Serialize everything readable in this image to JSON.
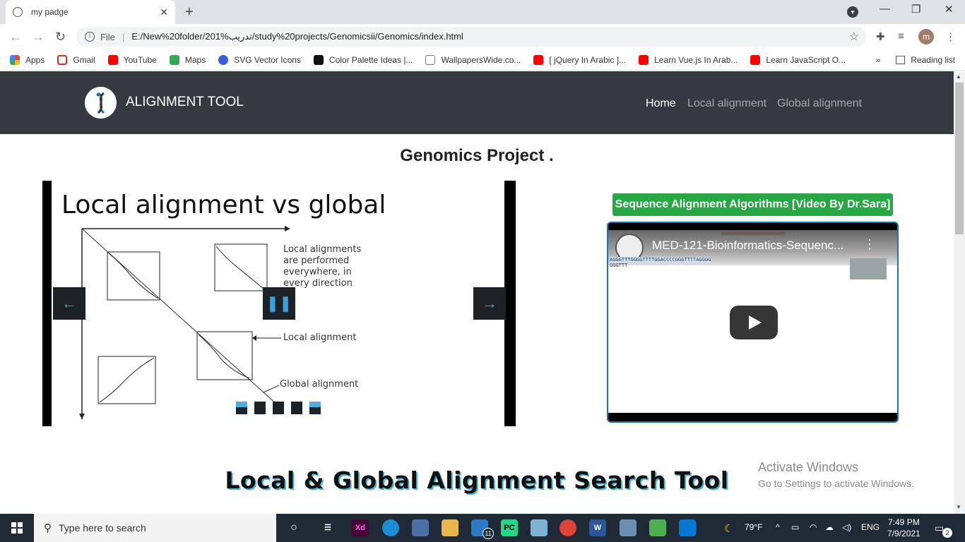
{
  "browser": {
    "tab_title": "my padge",
    "tab_close": "✕",
    "new_tab": "+",
    "url_scheme": "File",
    "url_separator": "|",
    "url": "E:/New%20folder/201%تدريب/study%20projects/Genomicsii/Genomics/index.html",
    "bookmarks": [
      {
        "label": "Apps",
        "color": "#e8453c"
      },
      {
        "label": "Gmail",
        "color": "#d93025"
      },
      {
        "label": "YouTube",
        "color": "#ff0000"
      },
      {
        "label": "Maps",
        "color": "#34a853"
      },
      {
        "label": "SVG Vector Icons",
        "color": "#3b5bdb"
      },
      {
        "label": "Color Palette Ideas |...",
        "color": "#111111"
      },
      {
        "label": "WallpapersWide.co...",
        "color": "#777777"
      },
      {
        "label": "[ jQuery In Arabic ]...",
        "color": "#ff0000"
      },
      {
        "label": "Learn Vue.js In Arab...",
        "color": "#ff0000"
      },
      {
        "label": "Learn JavaScript O...",
        "color": "#ff0000"
      }
    ],
    "bookmarks_more": "»",
    "reading_list": "Reading list",
    "profile_initial": "m"
  },
  "navbar": {
    "brand": "ALIGNMENT TOOL",
    "links": [
      "Home",
      "Local alignment",
      "Global alignment"
    ]
  },
  "main": {
    "heading": "Genomics Project .",
    "slide": {
      "title": "Local alignment vs global",
      "note": "Local alignments are performed everywhere, in every direction",
      "label_local": "Local alignment",
      "label_global": "Global alignment"
    },
    "video": {
      "caption": "Sequence Alignment Algorithms [Video By Dr.Sara]",
      "title": "MED-121-Bioinformatics-Sequenc...",
      "sequence_line1": "AGGGTTTGGGGTTTTGGACCCCGGGTTTTAGGGG",
      "sequence_line2": "GGGTTT"
    },
    "tool_heading": "Local & Global Alignment Search Tool"
  },
  "watermark": {
    "line1": "Activate Windows",
    "line2": "Go to Settings to activate Windows."
  },
  "taskbar": {
    "search_placeholder": "Type here to search",
    "weather": "79°F",
    "language": "ENG",
    "time": "7:49 PM",
    "date": "7/9/2021",
    "mail_badge": "11",
    "notif_badge": "2"
  }
}
